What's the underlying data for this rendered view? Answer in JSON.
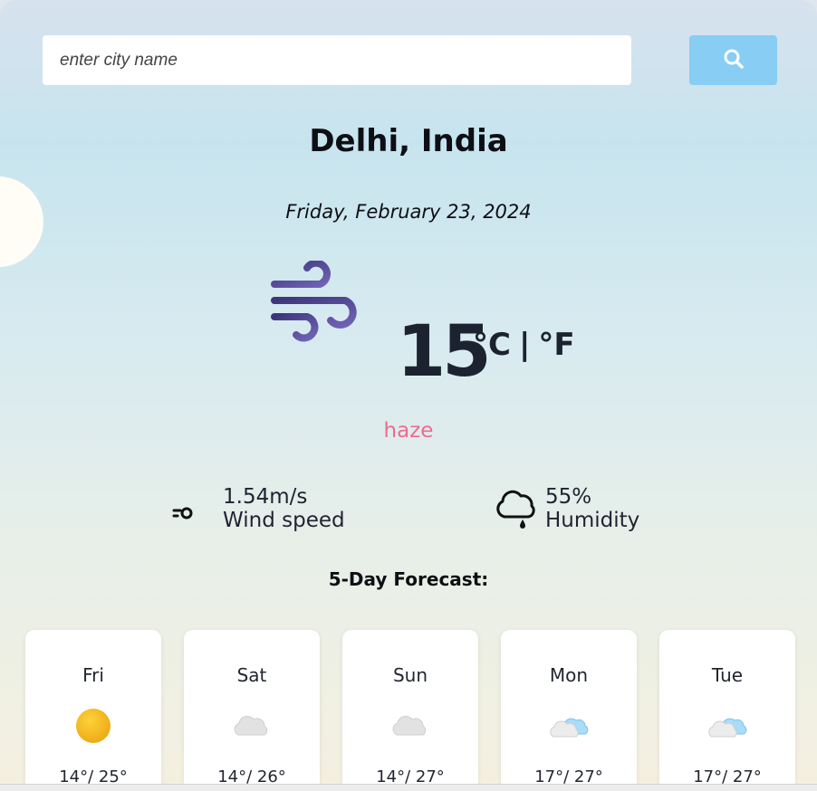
{
  "search": {
    "placeholder": "enter city name",
    "button_icon": "search-icon"
  },
  "location": {
    "city_line": "Delhi, India",
    "date": "Friday, February 23, 2024"
  },
  "current": {
    "icon": "wind-icon",
    "temperature": "15",
    "unit_c": "°C",
    "unit_sep": "|",
    "unit_f": "°F",
    "description": "haze"
  },
  "stats": {
    "wind": {
      "icon": "wind-gust-icon",
      "value": "1.54m/s",
      "label": "Wind speed"
    },
    "humidity": {
      "icon": "humidity-cloud-icon",
      "value": "55%",
      "label": "Humidity"
    }
  },
  "forecast": {
    "title": "5-Day Forecast:",
    "days": [
      {
        "day": "Fri",
        "icon": "sun-icon",
        "temps": "14°/ 25°"
      },
      {
        "day": "Sat",
        "icon": "cloud-icon",
        "temps": "14°/ 26°"
      },
      {
        "day": "Sun",
        "icon": "cloud-icon",
        "temps": "14°/ 27°"
      },
      {
        "day": "Mon",
        "icon": "partly-cloudy-icon",
        "temps": "17°/ 27°"
      },
      {
        "day": "Tue",
        "icon": "partly-cloudy-icon",
        "temps": "17°/ 27°"
      }
    ]
  },
  "colors": {
    "accent_button": "#88cdf4",
    "description": "#ee6b8d",
    "wind_icon": "#5a4a9a"
  }
}
